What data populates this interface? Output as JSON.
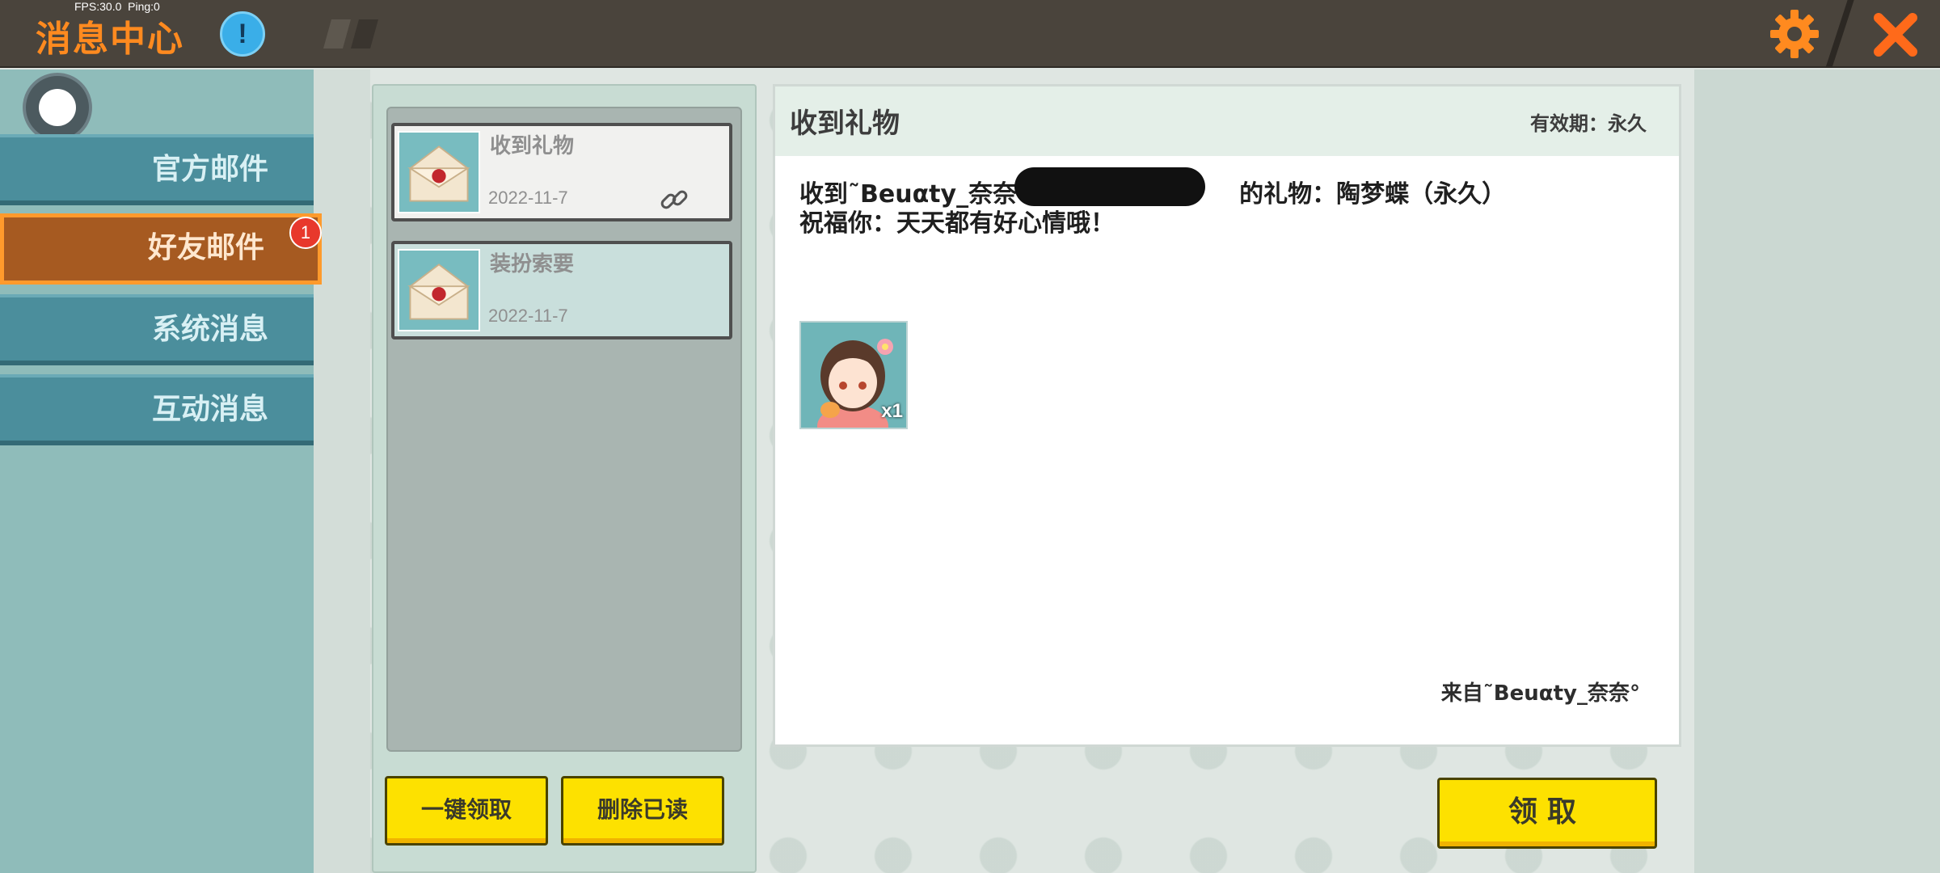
{
  "overlay": {
    "fps_text": "FPS:30.0  Ping:0"
  },
  "header": {
    "title": "消息中心",
    "info_icon": "info-icon",
    "info_label": "!",
    "settings_icon": "gear-icon",
    "close_icon": "close-icon"
  },
  "sidebar": {
    "items": [
      {
        "label": "官方邮件",
        "active": false
      },
      {
        "label": "好友邮件",
        "active": true,
        "badge": "1"
      },
      {
        "label": "系统消息",
        "active": false
      },
      {
        "label": "互动消息",
        "active": false
      }
    ]
  },
  "mail_list": {
    "items": [
      {
        "subject": "收到礼物",
        "date": "2022-11-7",
        "has_attachment": true,
        "icon": "envelope-icon"
      },
      {
        "subject": "装扮索要",
        "date": "2022-11-7",
        "has_attachment": false,
        "icon": "envelope-icon"
      }
    ],
    "collect_all_label": "一键领取",
    "delete_read_label": "删除已读"
  },
  "detail": {
    "title": "收到礼物",
    "validity": "有效期：永久",
    "line1_prefix": "收到˜Beuαty_奈奈°（",
    "line1_suffix": "的礼物：陶梦蝶（永久）",
    "line2": "祝福你：天天都有好心情哦！",
    "gift_quantity": "x1",
    "sender": "来自˜Beuαty_奈奈°",
    "claim_label": "领取"
  },
  "colors": {
    "accent_orange": "#ff8a1f",
    "sidebar_teal": "#4b8e9c",
    "active_item": "#a65a21",
    "button_yellow": "#fde100"
  }
}
